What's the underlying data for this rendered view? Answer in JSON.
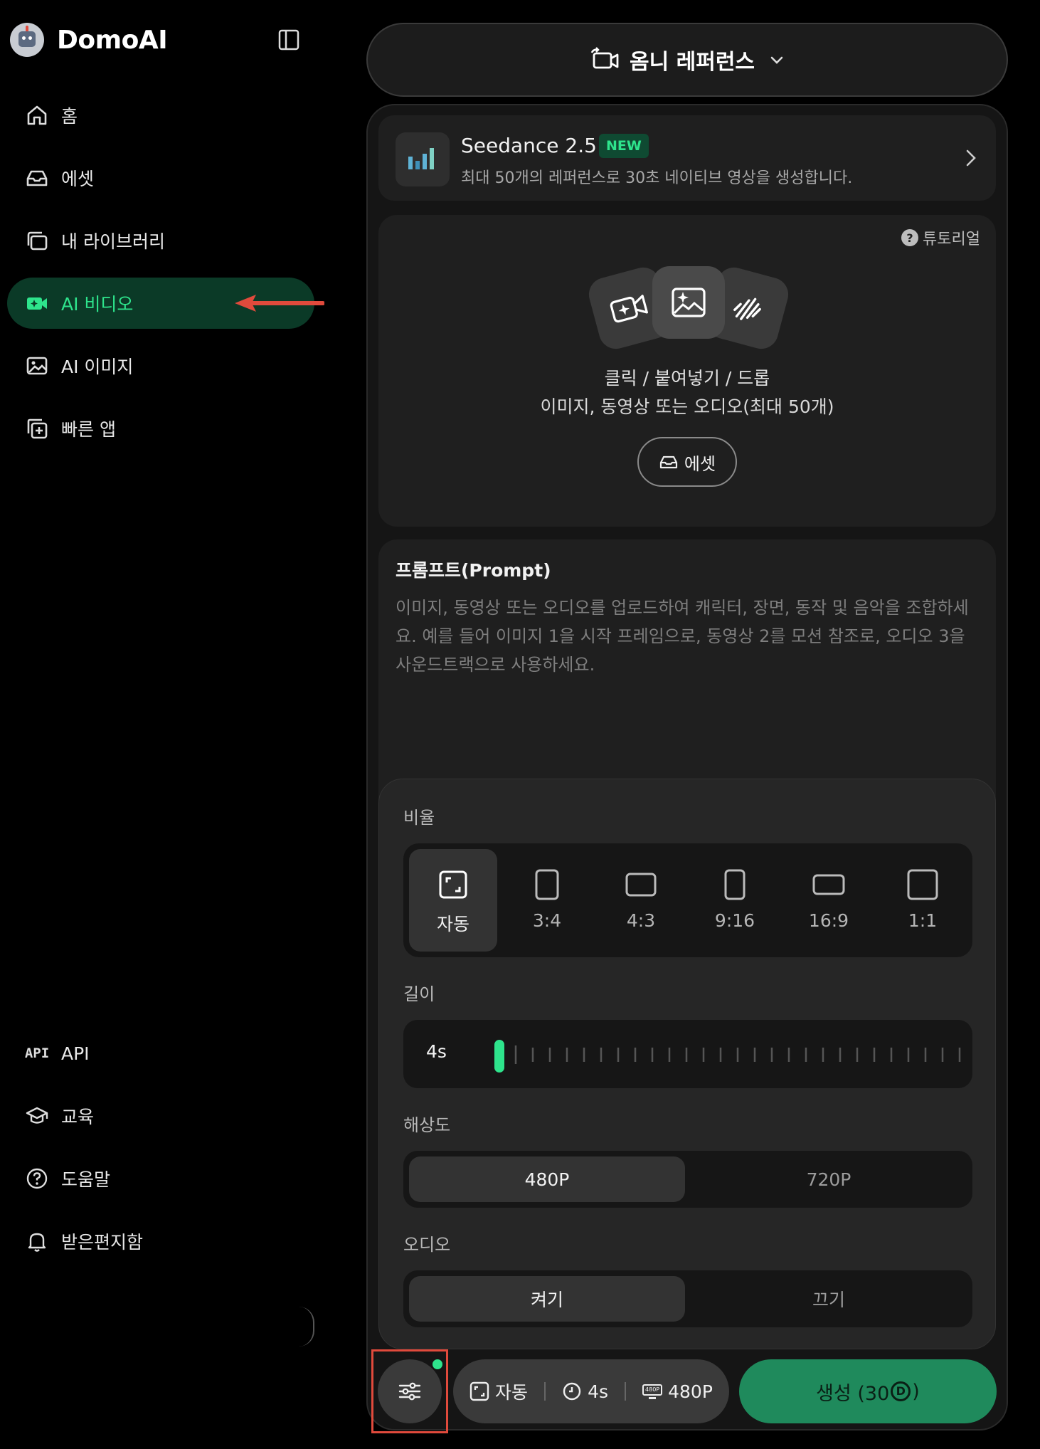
{
  "app": {
    "name": "DomoAI"
  },
  "sidebar": {
    "items": [
      {
        "label": "홈"
      },
      {
        "label": "에셋"
      },
      {
        "label": "내 라이브러리"
      },
      {
        "label": "AI 비디오"
      },
      {
        "label": "AI 이미지"
      },
      {
        "label": "빠른 앱"
      }
    ],
    "bottom_items": [
      {
        "label": "API",
        "icon_text": "API"
      },
      {
        "label": "교육"
      },
      {
        "label": "도움말"
      },
      {
        "label": "받은편지함"
      }
    ]
  },
  "mode": {
    "label": "옴니 레퍼런스"
  },
  "model": {
    "name": "Seedance 2.5",
    "badge": "NEW",
    "description": "최대 50개의 레퍼런스로 30초 네이티브 영상을 생성합니다."
  },
  "upload": {
    "tutorial": "튜토리얼",
    "line1": "클릭 / 붙여넣기 / 드롭",
    "line2": "이미지, 동영상 또는 오디오(최대 50개)",
    "asset_button": "에셋"
  },
  "prompt": {
    "title": "프롬프트(Prompt)",
    "placeholder": "이미지, 동영상 또는 오디오를 업로드하여 캐릭터, 장면, 동작 및 음악을 조합하세요. 예를 들어 이미지 1을 시작 프레임으로, 동영상 2를 모션 참조로, 오디오 3을 사운드트랙으로 사용하세요."
  },
  "settings": {
    "ratio_label": "비율",
    "ratios": [
      "자동",
      "3:4",
      "4:3",
      "9:16",
      "16:9",
      "1:1"
    ],
    "ratio_selected": "자동",
    "length_label": "길이",
    "length_value": "4s",
    "resolution_label": "해상도",
    "resolutions": [
      "480P",
      "720P"
    ],
    "resolution_selected": "480P",
    "audio_label": "오디오",
    "audio_options": [
      "켜기",
      "끄기"
    ],
    "audio_selected": "켜기"
  },
  "bottom_bar": {
    "summary_ratio": "자동",
    "summary_length": "4s",
    "summary_resolution": "480P",
    "resolution_icon_text": "480P",
    "generate_prefix": "생성 (30",
    "generate_coin": "D",
    "generate_suffix": ")"
  },
  "colors": {
    "accent": "#2ee48c",
    "active_nav_bg": "#0b3a27",
    "generate_bg": "#1f8a5c",
    "annotation_red": "#e04a3c"
  }
}
